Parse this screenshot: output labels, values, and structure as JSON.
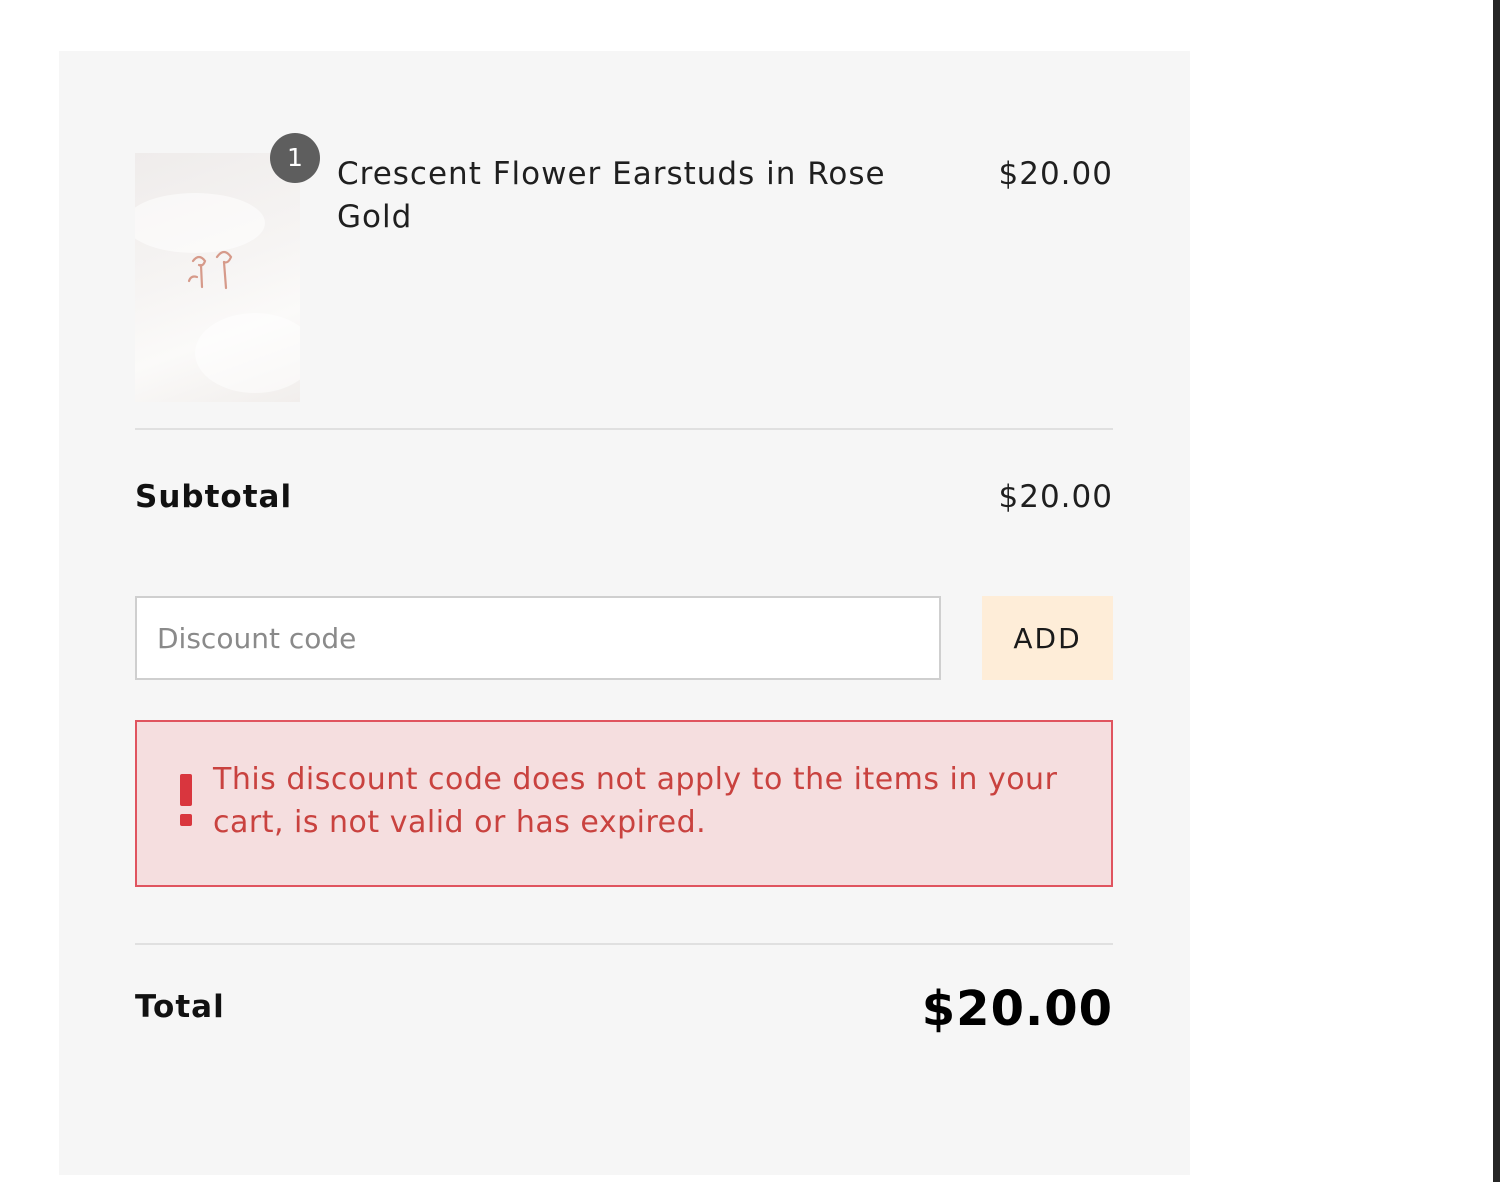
{
  "cart": {
    "line_items": [
      {
        "quantity": "1",
        "name": "Crescent Flower Earstuds in Rose Gold",
        "price": "$20.00"
      }
    ]
  },
  "summary": {
    "subtotal_label": "Subtotal",
    "subtotal_value": "$20.00",
    "total_label": "Total",
    "total_value": "$20.00"
  },
  "discount": {
    "placeholder": "Discount code",
    "value": "",
    "add_label": "ADD",
    "error_message": "This discount code does not apply to the items in your cart, is not valid or has expired."
  },
  "icons": {
    "error": "exclamation-icon",
    "product": "product-thumbnail"
  },
  "colors": {
    "panel_background": "#f6f6f6",
    "add_button": "#feedd8",
    "error_background": "#f5dedf",
    "error_border": "#e0545f",
    "error_text": "#c9423f",
    "badge": "#5e5e5e"
  }
}
